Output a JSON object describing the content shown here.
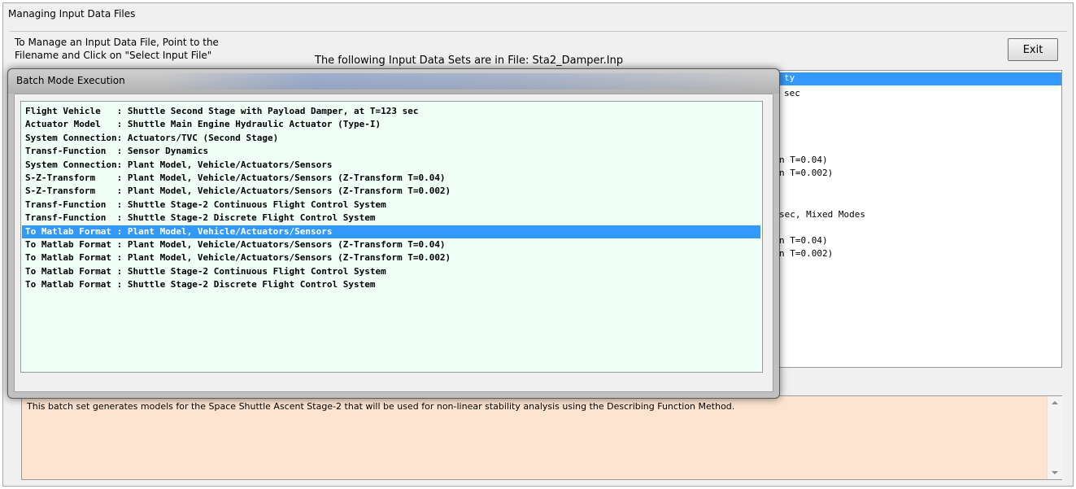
{
  "main_window": {
    "title": "Managing Input Data Files",
    "instruction_line1": "To Manage an Input Data File, Point to the",
    "instruction_line2": "Filename and Click on \"Select Input File\"",
    "file_info": "The following Input Data Sets are in File: Sta2_Damper.Inp",
    "exit_label": "Exit",
    "background_fragments": [
      "ty",
      "sec",
      "n T=0.04)",
      "n T=0.002)",
      "sec, Mixed Modes",
      "n T=0.04)",
      "n T=0.002)"
    ],
    "description": "This batch set generates models for the Space Shuttle Ascent Stage-2 that will be used for non-linear stability analysis using the Describing Function Method."
  },
  "dialog": {
    "title": "Batch Mode Execution",
    "selected_index": 9,
    "items": [
      "Flight Vehicle   : Shuttle Second Stage with Payload Damper, at T=123 sec",
      "Actuator Model   : Shuttle Main Engine Hydraulic Actuator (Type-I)",
      "System Connection: Actuators/TVC (Second Stage)",
      "Transf-Function  : Sensor Dynamics",
      "System Connection: Plant Model, Vehicle/Actuators/Sensors",
      "S-Z-Transform    : Plant Model, Vehicle/Actuators/Sensors (Z-Transform T=0.04)",
      "S-Z-Transform    : Plant Model, Vehicle/Actuators/Sensors (Z-Transform T=0.002)",
      "Transf-Function  : Shuttle Stage-2 Continuous Flight Control System",
      "Transf-Function  : Shuttle Stage-2 Discrete Flight Control System",
      "To Matlab Format : Plant Model, Vehicle/Actuators/Sensors",
      "To Matlab Format : Plant Model, Vehicle/Actuators/Sensors (Z-Transform T=0.04)",
      "To Matlab Format : Plant Model, Vehicle/Actuators/Sensors (Z-Transform T=0.002)",
      "To Matlab Format : Shuttle Stage-2 Continuous Flight Control System",
      "To Matlab Format : Shuttle Stage-2 Discrete Flight Control System"
    ]
  },
  "colors": {
    "selection": "#3399ff",
    "dialog_list_bg": "#f0fff8",
    "description_bg": "#fce4d0"
  },
  "icons": [
    "scroll-up-arrow-icon",
    "scroll-down-arrow-icon"
  ]
}
